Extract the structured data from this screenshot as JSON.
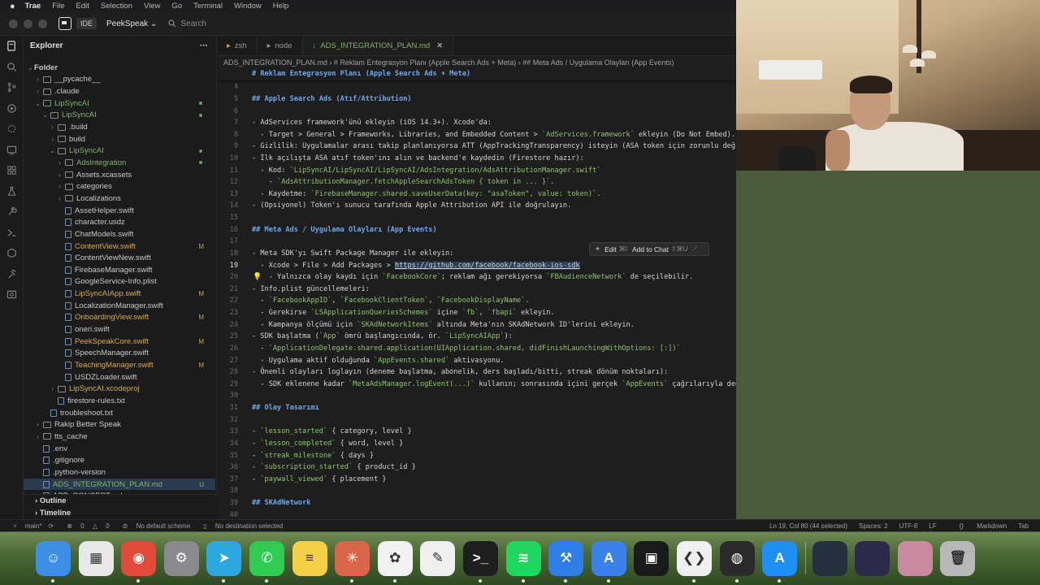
{
  "menubar": {
    "app": "Trae",
    "items": [
      "File",
      "Edit",
      "Selection",
      "View",
      "Go",
      "Terminal",
      "Window",
      "Help"
    ]
  },
  "titlebar": {
    "ide_tag": "IDE",
    "project": "PeekSpeak",
    "search_placeholder": "Search"
  },
  "sidebar": {
    "title": "Explorer",
    "more": "···",
    "rows": [
      {
        "label": "Folder",
        "depth": 0,
        "kind": "root",
        "expanded": true
      },
      {
        "label": "__pycache__",
        "depth": 1,
        "kind": "folder",
        "expanded": false
      },
      {
        "label": ".claude",
        "depth": 1,
        "kind": "folder",
        "expanded": false
      },
      {
        "label": "LipSyncAI",
        "depth": 1,
        "kind": "folder",
        "expanded": true,
        "color": "green",
        "dot": true
      },
      {
        "label": "LipSyncAI",
        "depth": 2,
        "kind": "folder",
        "expanded": true,
        "color": "green",
        "dot": true
      },
      {
        "label": ".build",
        "depth": 3,
        "kind": "folder",
        "expanded": false
      },
      {
        "label": "build",
        "depth": 3,
        "kind": "folder",
        "expanded": false
      },
      {
        "label": "LipSyncAI",
        "depth": 3,
        "kind": "folder",
        "expanded": true,
        "color": "green",
        "dot": true
      },
      {
        "label": "AdsIntegration",
        "depth": 4,
        "kind": "folder",
        "expanded": false,
        "color": "green",
        "dot": true
      },
      {
        "label": "Assets.xcassets",
        "depth": 4,
        "kind": "folder",
        "expanded": false
      },
      {
        "label": "categories",
        "depth": 4,
        "kind": "folder",
        "expanded": false
      },
      {
        "label": "Localizations",
        "depth": 4,
        "kind": "folder",
        "expanded": false
      },
      {
        "label": "AssetHelper.swift",
        "depth": 4,
        "kind": "file"
      },
      {
        "label": "character.usdz",
        "depth": 4,
        "kind": "file"
      },
      {
        "label": "ChatModels.swift",
        "depth": 4,
        "kind": "file"
      },
      {
        "label": "ContentView.swift",
        "depth": 4,
        "kind": "file",
        "color": "mod",
        "badge": "M"
      },
      {
        "label": "ContentViewNew.swift",
        "depth": 4,
        "kind": "file"
      },
      {
        "label": "FirebaseManager.swift",
        "depth": 4,
        "kind": "file"
      },
      {
        "label": "GoogleService-Info.plist",
        "depth": 4,
        "kind": "file"
      },
      {
        "label": "LipSyncAIApp.swift",
        "depth": 4,
        "kind": "file",
        "color": "mod",
        "badge": "M"
      },
      {
        "label": "LocalizationManager.swift",
        "depth": 4,
        "kind": "file"
      },
      {
        "label": "OnboardingView.swift",
        "depth": 4,
        "kind": "file",
        "color": "mod",
        "badge": "M"
      },
      {
        "label": "oneri.swift",
        "depth": 4,
        "kind": "file"
      },
      {
        "label": "PeekSpeakCore.swift",
        "depth": 4,
        "kind": "file",
        "color": "mod",
        "badge": "M"
      },
      {
        "label": "SpeechManager.swift",
        "depth": 4,
        "kind": "file"
      },
      {
        "label": "TeachingManager.swift",
        "depth": 4,
        "kind": "file",
        "color": "mod",
        "badge": "M"
      },
      {
        "label": "USDZLoader.swift",
        "depth": 4,
        "kind": "file"
      },
      {
        "label": "LipSyncAI.xcodeproj",
        "depth": 3,
        "kind": "folder",
        "expanded": false,
        "color": "mod"
      },
      {
        "label": "firestore-rules.txt",
        "depth": 3,
        "kind": "file"
      },
      {
        "label": "troubleshoot.txt",
        "depth": 2,
        "kind": "file"
      },
      {
        "label": "Rakip Better Speak",
        "depth": 1,
        "kind": "folder",
        "expanded": false
      },
      {
        "label": "tts_cache",
        "depth": 1,
        "kind": "folder",
        "expanded": false
      },
      {
        "label": ".env",
        "depth": 1,
        "kind": "file"
      },
      {
        "label": ".gitignore",
        "depth": 1,
        "kind": "file"
      },
      {
        "label": ".python-version",
        "depth": 1,
        "kind": "file"
      },
      {
        "label": "ADS_INTEGRATION_PLAN.md",
        "depth": 1,
        "kind": "file",
        "color": "green",
        "badge": "U",
        "selected": true
      },
      {
        "label": "APP_CONCEPT.md",
        "depth": 1,
        "kind": "file"
      }
    ],
    "outline": "Outline",
    "timeline": "Timeline"
  },
  "tabs": [
    {
      "label": "zsh",
      "active": false
    },
    {
      "label": "node",
      "active": false
    },
    {
      "label": "ADS_INTEGRATION_PLAN.md",
      "active": true
    }
  ],
  "breadcrumb": [
    "ADS_INTEGRATION_PLAN.md",
    "# Reklam Entegrasyon Planı (Apple Search Ads + Meta)",
    "## Meta Ads / Uygulama Olayları (App Events)"
  ],
  "sticky_header": "# Reklam Entegrasyon Planı (Apple Search Ads + Meta)",
  "code_lines": [
    {
      "n": "4",
      "segs": []
    },
    {
      "n": "5",
      "segs": [
        {
          "t": "## Apple Search Ads (Atıf/Attribution)",
          "c": "hd"
        }
      ]
    },
    {
      "n": "6",
      "segs": []
    },
    {
      "n": "7",
      "segs": [
        {
          "t": "- AdServices framework'ünü ekleyin (iOS 14.3+). Xcode'da:"
        }
      ]
    },
    {
      "n": "8",
      "segs": [
        {
          "t": "  - Target > General > Frameworks, Libraries, and Embedded Content > "
        },
        {
          "t": "`AdServices.framework`",
          "c": "cd"
        },
        {
          "t": " ekleyin (Do Not Embed)."
        }
      ]
    },
    {
      "n": "9",
      "segs": [
        {
          "t": "- Gizlilik: Uygulamalar arası takip planlanıyorsa ATT (AppTrackingTransparency) isteyin (ASA token için zorunlu değ"
        }
      ]
    },
    {
      "n": "10",
      "segs": [
        {
          "t": "- İlk açılışta ASA atıf token'ını alın ve backend'e kaydedin (Firestore hazır):"
        }
      ]
    },
    {
      "n": "11",
      "segs": [
        {
          "t": "  - Kod: "
        },
        {
          "t": "`LipSyncAI/LipSyncAI/LipSyncAI/AdsIntegration/AdsAttributionManager.swift`",
          "c": "cd"
        }
      ]
    },
    {
      "n": "12",
      "segs": [
        {
          "t": "    - "
        },
        {
          "t": "`AdsAttributionManager.fetchAppleSearchAdsToken { token in ... }`",
          "c": "cd"
        },
        {
          "t": "."
        }
      ]
    },
    {
      "n": "13",
      "segs": [
        {
          "t": "  - Kaydetme: "
        },
        {
          "t": "`FirebaseManager.shared.saveUserData(key: \"asaToken\", value: token)`",
          "c": "cd"
        },
        {
          "t": "."
        }
      ]
    },
    {
      "n": "14",
      "segs": [
        {
          "t": "- (Opsiyonel) Token'ı sunucu tarafında Apple Attribution API ile doğrulayın."
        }
      ]
    },
    {
      "n": "15",
      "segs": []
    },
    {
      "n": "16",
      "segs": [
        {
          "t": "## Meta Ads / Uygulama Olayları (App Events)",
          "c": "hd"
        }
      ]
    },
    {
      "n": "17",
      "segs": []
    },
    {
      "n": "18",
      "segs": [
        {
          "t": "- Meta SDK'yı Swift Package Manager ile ekleyin:"
        }
      ]
    },
    {
      "n": "19",
      "cur": true,
      "segs": [
        {
          "t": "  - Xcode > File > Add Packages > "
        },
        {
          "t": "https://github.com/facebook/facebook-ios-sdk",
          "c": "link"
        }
      ]
    },
    {
      "n": "20",
      "bulb": true,
      "segs": [
        {
          "t": "    - Yalnızca olay kaydı için "
        },
        {
          "t": "`FacebookCore`",
          "c": "cd"
        },
        {
          "t": "; reklam ağı gerekiyorsa "
        },
        {
          "t": "`FBAudienceNetwork`",
          "c": "cd"
        },
        {
          "t": " de seçilebilir."
        }
      ]
    },
    {
      "n": "21",
      "segs": [
        {
          "t": "- Info.plist güncellemeleri:"
        }
      ]
    },
    {
      "n": "22",
      "segs": [
        {
          "t": "  - "
        },
        {
          "t": "`FacebookAppID`",
          "c": "cd"
        },
        {
          "t": ", "
        },
        {
          "t": "`FacebookClientToken`",
          "c": "cd"
        },
        {
          "t": ", "
        },
        {
          "t": "`FacebookDisplayName`",
          "c": "cd"
        },
        {
          "t": "."
        }
      ]
    },
    {
      "n": "23",
      "segs": [
        {
          "t": "  - Gerekirse "
        },
        {
          "t": "`LSApplicationQueriesSchemes`",
          "c": "cd"
        },
        {
          "t": " içine "
        },
        {
          "t": "`fb`",
          "c": "cd"
        },
        {
          "t": ", "
        },
        {
          "t": "`fbapi`",
          "c": "cd"
        },
        {
          "t": " ekleyin."
        }
      ]
    },
    {
      "n": "24",
      "segs": [
        {
          "t": "  - Kampanya ölçümü için "
        },
        {
          "t": "`SKAdNetworkItems`",
          "c": "cd"
        },
        {
          "t": " altında Meta'nın SKAdNetwork ID'lerini ekleyin."
        }
      ]
    },
    {
      "n": "25",
      "segs": [
        {
          "t": "- SDK başlatma ("
        },
        {
          "t": "`App`",
          "c": "cd"
        },
        {
          "t": " ömrü başlangıcında, ör. "
        },
        {
          "t": "`LipSyncAIApp`",
          "c": "cd"
        },
        {
          "t": "):"
        }
      ]
    },
    {
      "n": "26",
      "segs": [
        {
          "t": "  - "
        },
        {
          "t": "`ApplicationDelegate.shared.application(UIApplication.shared, didFinishLaunchingWithOptions: [:])`",
          "c": "cd"
        }
      ]
    },
    {
      "n": "27",
      "segs": [
        {
          "t": "  - Uygulama aktif olduğunda "
        },
        {
          "t": "`AppEvents.shared`",
          "c": "cd"
        },
        {
          "t": " aktivasyonu."
        }
      ]
    },
    {
      "n": "28",
      "segs": [
        {
          "t": "- Önemli olayları loglayın (deneme başlatma, abonelik, ders başladı/bitti, streak dönüm noktaları):"
        }
      ]
    },
    {
      "n": "29",
      "segs": [
        {
          "t": "  - SDK eklenene kadar "
        },
        {
          "t": "`MetaAdsManager.logEvent(...)`",
          "c": "cd"
        },
        {
          "t": " kullanın; sonrasında içini gerçek "
        },
        {
          "t": "`AppEvents`",
          "c": "cd"
        },
        {
          "t": " çağrılarıyla değiştirin."
        }
      ]
    },
    {
      "n": "30",
      "segs": []
    },
    {
      "n": "31",
      "segs": [
        {
          "t": "## Olay Tasarımı",
          "c": "hd"
        }
      ]
    },
    {
      "n": "32",
      "segs": []
    },
    {
      "n": "33",
      "segs": [
        {
          "t": "- "
        },
        {
          "t": "`lesson_started`",
          "c": "cd"
        },
        {
          "t": " { category, level }"
        }
      ]
    },
    {
      "n": "34",
      "segs": [
        {
          "t": "- "
        },
        {
          "t": "`lesson_completed`",
          "c": "cd"
        },
        {
          "t": " { word, level }"
        }
      ]
    },
    {
      "n": "35",
      "segs": [
        {
          "t": "- "
        },
        {
          "t": "`streak_milestone`",
          "c": "cd"
        },
        {
          "t": " { days }"
        }
      ]
    },
    {
      "n": "36",
      "segs": [
        {
          "t": "- "
        },
        {
          "t": "`subscription_started`",
          "c": "cd"
        },
        {
          "t": " { product_id }"
        }
      ]
    },
    {
      "n": "37",
      "segs": [
        {
          "t": "- "
        },
        {
          "t": "`paywall_viewed`",
          "c": "cd"
        },
        {
          "t": " { placement }"
        }
      ]
    },
    {
      "n": "38",
      "segs": []
    },
    {
      "n": "39",
      "segs": [
        {
          "t": "## SKAdNetwork",
          "c": "hd"
        }
      ]
    },
    {
      "n": "40",
      "segs": []
    }
  ],
  "popup": {
    "edit": "Edit",
    "edit_key": "⌘I",
    "chat": "Add to Chat",
    "chat_key": "⇧⌘U"
  },
  "statusbar": {
    "branch": "main*",
    "errors": "0",
    "warnings": "0",
    "scheme": "No default scheme",
    "destination": "No destination selected",
    "position": "Ln 19, Col 80 (44 selected)",
    "spaces": "Spaces: 2",
    "encoding": "UTF-8",
    "eol": "LF",
    "language": "Markdown",
    "tab": "Tab"
  },
  "dock": [
    {
      "name": "finder",
      "glyph": "☺",
      "bg": "#3d8fe6"
    },
    {
      "name": "launchpad",
      "glyph": "▦",
      "bg": "#e8e8e8"
    },
    {
      "name": "chrome",
      "glyph": "◉",
      "bg": "#e24a3a"
    },
    {
      "name": "system-settings",
      "glyph": "⚙",
      "bg": "#8a8a8e"
    },
    {
      "name": "telegram",
      "glyph": "➤",
      "bg": "#2ea6e0"
    },
    {
      "name": "whatsapp",
      "glyph": "✆",
      "bg": "#2fcc52"
    },
    {
      "name": "notes",
      "glyph": "≡",
      "bg": "#f5d047"
    },
    {
      "name": "claude",
      "glyph": "✳",
      "bg": "#d9664a"
    },
    {
      "name": "chatgpt",
      "glyph": "✿",
      "bg": "#f2f2f2"
    },
    {
      "name": "textedit",
      "glyph": "✎",
      "bg": "#f0f0f0"
    },
    {
      "name": "terminal",
      "glyph": ">_",
      "bg": "#1e1e1e"
    },
    {
      "name": "spotify",
      "glyph": "≋",
      "bg": "#1ed760"
    },
    {
      "name": "xcode",
      "glyph": "⚒",
      "bg": "#2f7ee8"
    },
    {
      "name": "instruments",
      "glyph": "A",
      "bg": "#3a82e8"
    },
    {
      "name": "android-studio",
      "glyph": "▣",
      "bg": "#1a1a1a"
    },
    {
      "name": "vscode",
      "glyph": "❮❯",
      "bg": "#f0f0f0"
    },
    {
      "name": "obs",
      "glyph": "◍",
      "bg": "#2b2b2b"
    },
    {
      "name": "app-store",
      "glyph": "A",
      "bg": "#1e8ff5"
    },
    {
      "name": "separator",
      "glyph": "",
      "bg": ""
    },
    {
      "name": "recent-window-1",
      "glyph": "",
      "bg": "#24303f"
    },
    {
      "name": "recent-window-2",
      "glyph": "",
      "bg": "#2c2a4a"
    },
    {
      "name": "iphone-mirroring",
      "glyph": "",
      "bg": "#c98aa0"
    },
    {
      "name": "trash",
      "glyph": "🗑",
      "bg": "#b8b8b8"
    }
  ]
}
